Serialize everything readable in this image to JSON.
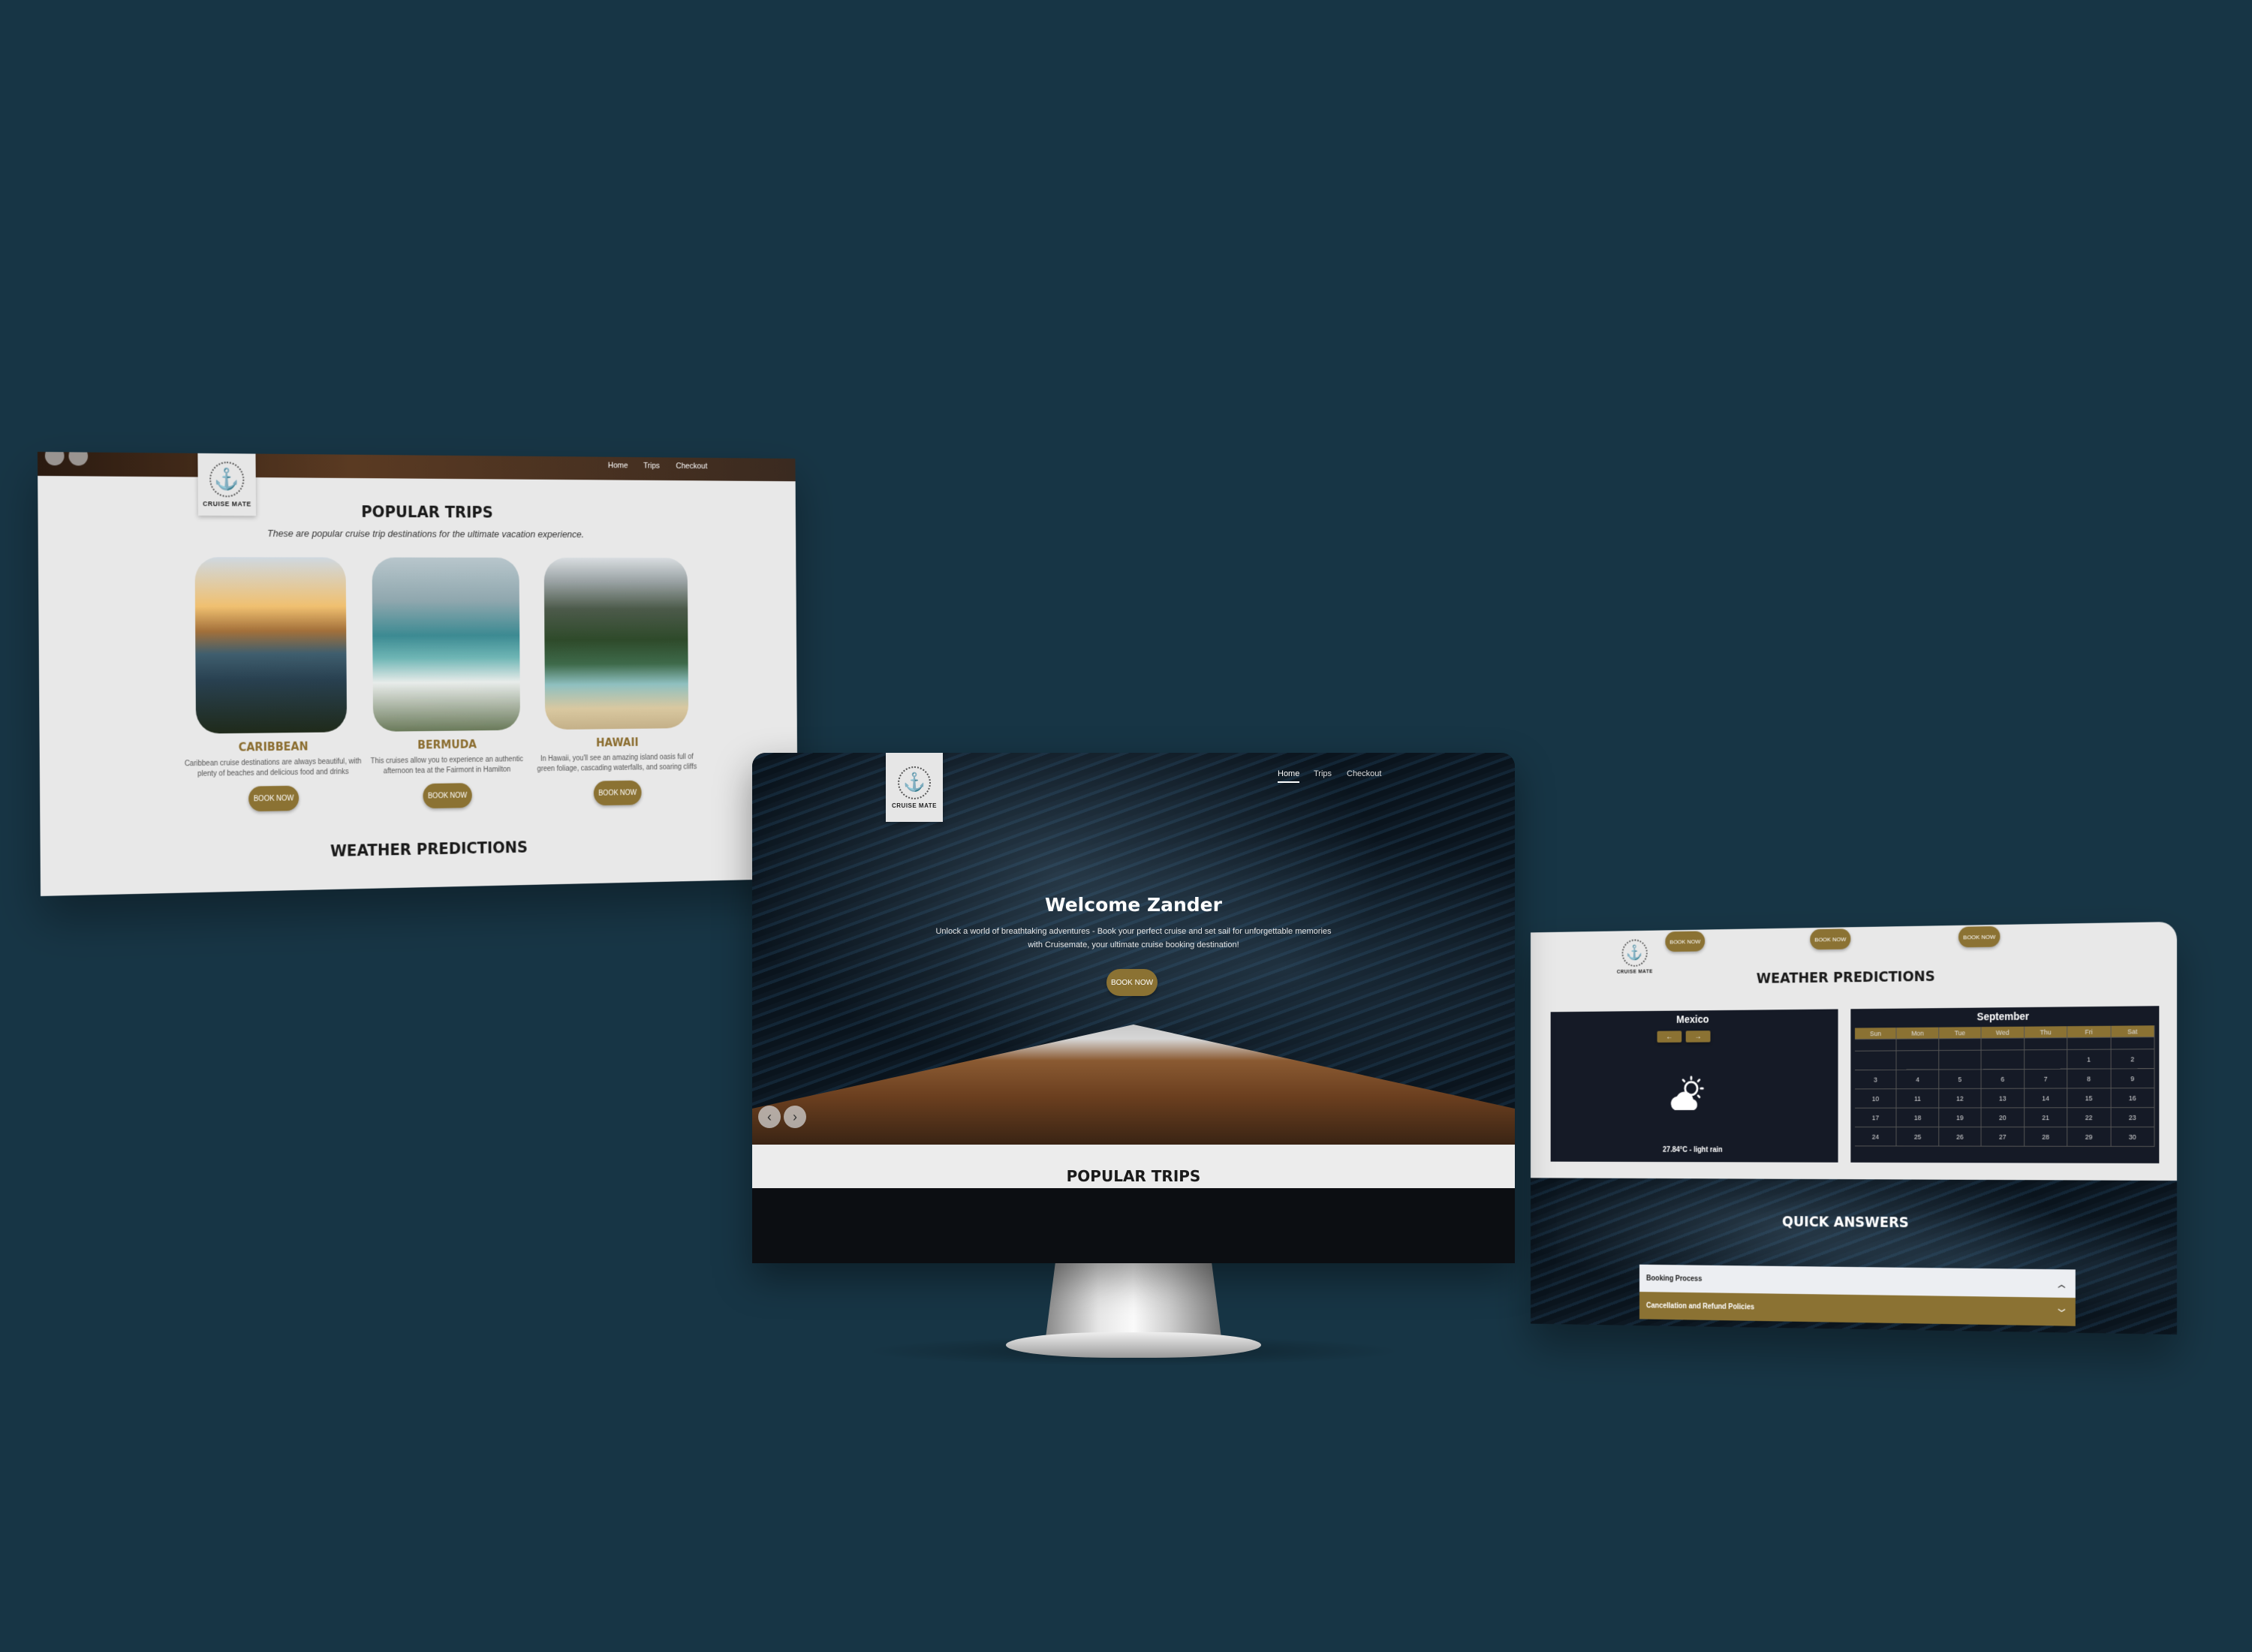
{
  "brand": {
    "logo_text": "CRUISE MATE"
  },
  "nav": {
    "items": [
      "Home",
      "Trips",
      "Checkout"
    ]
  },
  "popular": {
    "title": "POPULAR TRIPS",
    "subtitle": "These are popular cruise trip destinations for the ultimate vacation experience.",
    "trips": [
      {
        "name": "CARIBBEAN",
        "desc": "Caribbean cruise destinations are always beautiful, with plenty of beaches and delicious food and drinks",
        "button": "BOOK NOW"
      },
      {
        "name": "BERMUDA",
        "desc": "This cruises allow you to experience an authentic afternoon tea at the Fairmont in Hamilton",
        "button": "BOOK NOW"
      },
      {
        "name": "HAWAII",
        "desc": "In Hawaii, you'll see an amazing island oasis full of green foliage, cascading waterfalls, and soaring cliffs",
        "button": "BOOK NOW"
      }
    ]
  },
  "weather_title": "WEATHER PREDICTIONS",
  "hero": {
    "title": "Welcome Zander",
    "text_line1": "Unlock a world of breathtaking adventures - Book your perfect cruise and set sail for unforgettable memories",
    "text_line2": "with Cruisemate, your ultimate cruise booking destination!",
    "button": "BOOK NOW",
    "section_below": "POPULAR TRIPS"
  },
  "weather": {
    "location": "Mexico",
    "prev": "←",
    "next": "→",
    "reading": "27.84°C - light rain",
    "icon": "partly-cloudy-sun-icon",
    "top_buttons": [
      "BOOK NOW",
      "BOOK NOW",
      "BOOK NOW"
    ]
  },
  "calendar": {
    "month": "September",
    "days": [
      "Sun",
      "Mon",
      "Tue",
      "Wed",
      "Thu",
      "Fri",
      "Sat"
    ],
    "rows": [
      [
        "",
        "",
        "",
        "",
        "",
        "1",
        "2"
      ],
      [
        "3",
        "4",
        "5",
        "6",
        "7",
        "8",
        "9"
      ],
      [
        "10",
        "11",
        "12",
        "13",
        "14",
        "15",
        "16"
      ],
      [
        "17",
        "18",
        "19",
        "20",
        "21",
        "22",
        "23"
      ],
      [
        "24",
        "25",
        "26",
        "27",
        "28",
        "29",
        "30"
      ]
    ]
  },
  "faq": {
    "title": "QUICK ANSWERS",
    "items": [
      {
        "label": "Booking Process",
        "state": "open"
      },
      {
        "label": "Cancellation and Refund Policies",
        "state": "closed"
      }
    ]
  },
  "colors": {
    "background": "#173545",
    "gold": "#8b7233",
    "panel": "#e8e8e8",
    "dark": "#151a26"
  }
}
